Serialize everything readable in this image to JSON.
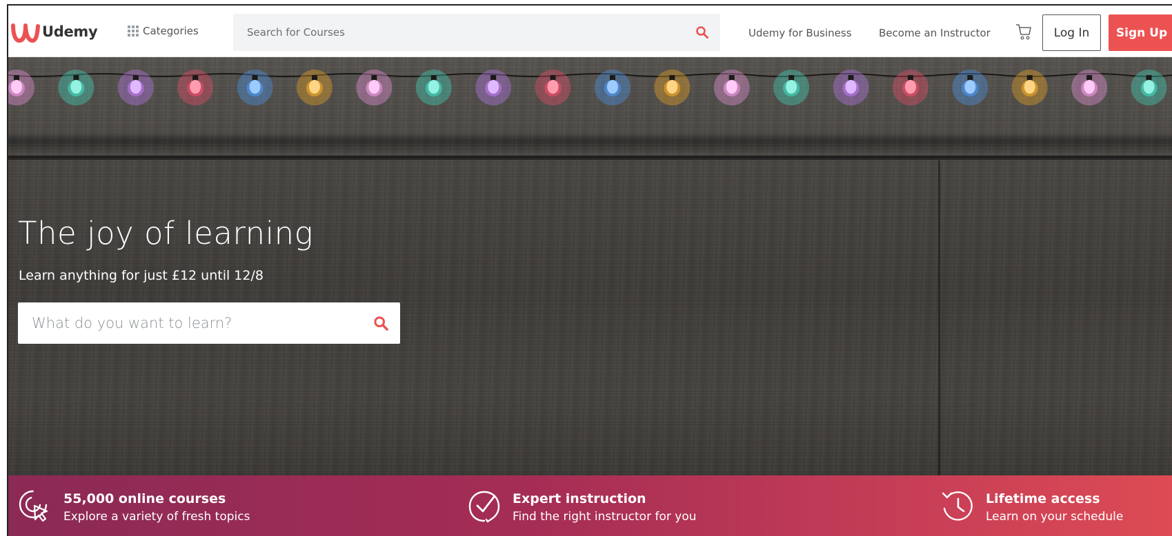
{
  "header": {
    "logo_text": "Udemy",
    "brand_color": "#ec5252",
    "categories_label": "Categories",
    "search_placeholder": "Search for Courses",
    "nav_business": "Udemy for Business",
    "nav_instructor": "Become an Instructor",
    "login_label": "Log In",
    "signup_label": "Sign Up"
  },
  "hero": {
    "title": "The joy of learning",
    "subtitle": "Learn anything for just £12 until 12/8",
    "search_placeholder": "What do you want to learn?"
  },
  "features": [
    {
      "icon": "cursor-click-icon",
      "title": "55,000 online courses",
      "description": "Explore a variety of fresh topics"
    },
    {
      "icon": "check-badge-icon",
      "title": "Expert instruction",
      "description": "Find the right instructor for you"
    },
    {
      "icon": "clock-history-icon",
      "title": "Lifetime access",
      "description": "Learn on your schedule"
    }
  ]
}
